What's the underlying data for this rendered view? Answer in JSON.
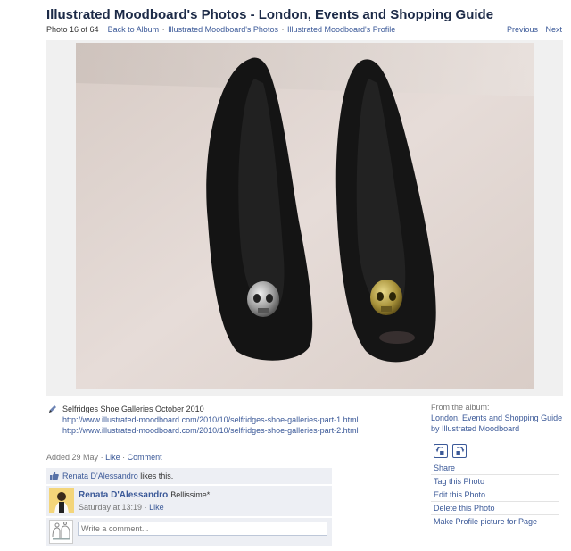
{
  "header": {
    "title": "Illustrated Moodboard's Photos - London, Events and Shopping Guide",
    "photo_counter": "Photo 16 of 64",
    "breadcrumbs": [
      "Back to Album",
      "Illustrated Moodboard's Photos",
      "Illustrated Moodboard's Profile"
    ],
    "separator": "·",
    "pager": {
      "previous": "Previous",
      "next": "Next"
    }
  },
  "photo": {
    "subject": "pair of black peep-toe heels with skull ornaments"
  },
  "caption": {
    "text": "Selfridges Shoe Galleries October 2010",
    "links": [
      "http://www.illustrated-moodboard.com/2010/10/selfridges-shoe-galleries-part-1.html",
      "http://www.illustrated-moodboard.com/2010/10/selfridges-shoe-galleries-part-2.html"
    ]
  },
  "meta": {
    "added": "Added 29 May",
    "like": "Like",
    "comment": "Comment",
    "separator": "·"
  },
  "likes": {
    "name": "Renata D'Alessandro",
    "suffix": "likes this."
  },
  "comment": {
    "author": "Renata D'Alessandro",
    "body": "Bellissime*",
    "timestamp": "Saturday at 13:19",
    "like": "Like",
    "separator": "·"
  },
  "write_comment": {
    "placeholder": "Write a comment..."
  },
  "album": {
    "label": "From the album:",
    "name": "London, Events and Shopping Guide",
    "by_prefix": "by",
    "owner": "Illustrated Moodboard"
  },
  "actions": {
    "share": "Share",
    "items": [
      "Tag this Photo",
      "Edit this Photo",
      "Delete this Photo",
      "Make Profile picture for Page"
    ]
  },
  "colors": {
    "link": "#3b5998",
    "title": "#1c2a47",
    "panel": "#edeff4"
  }
}
